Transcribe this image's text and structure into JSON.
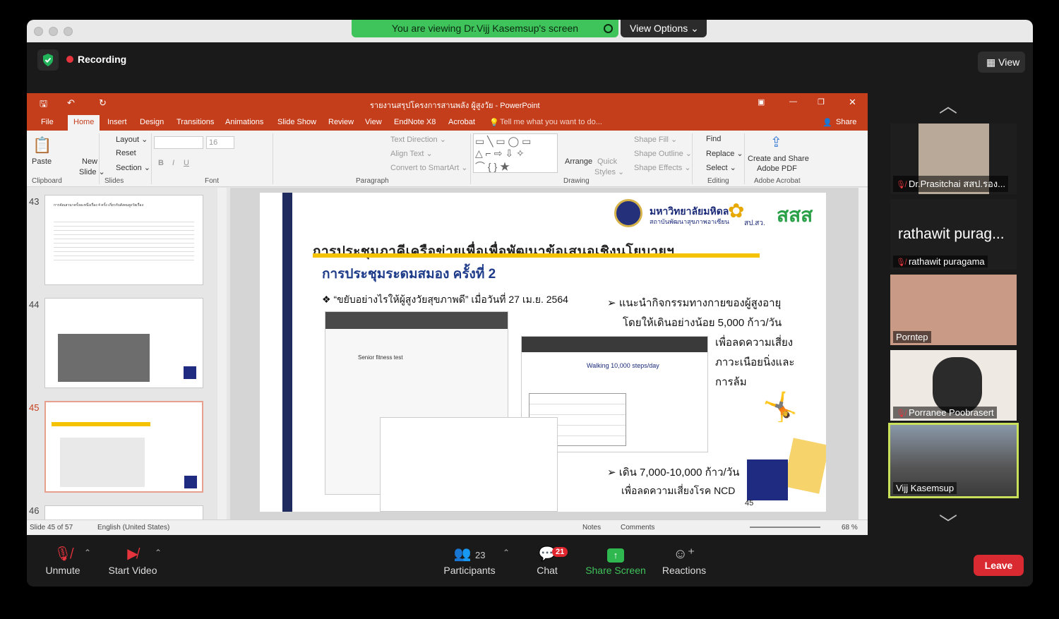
{
  "banner": {
    "viewing": "You are viewing Dr.Vijj Kasemsup's screen",
    "view_options": "View Options ⌄"
  },
  "topbar": {
    "recording": "Recording",
    "view": "View"
  },
  "ppt": {
    "window_title": "รายงานสรุปโครงการสานพลัง ผู้สูงวัย - PowerPoint",
    "tabs": [
      "File",
      "Home",
      "Insert",
      "Design",
      "Transitions",
      "Animations",
      "Slide Show",
      "Review",
      "View",
      "EndNote X8",
      "Acrobat"
    ],
    "tell_me": "Tell me what you want to do...",
    "share": "Share",
    "ribbon": {
      "paste": "Paste",
      "clipboard": "Clipboard",
      "new_slide": "New",
      "new_slide2": "Slide ⌄",
      "layout": "Layout ⌄",
      "reset": "Reset",
      "section": "Section ⌄",
      "slides": "Slides",
      "font_size": "16",
      "font": "Font",
      "text_direction": "Text Direction ⌄",
      "align_text": "Align Text ⌄",
      "convert": "Convert to SmartArt ⌄",
      "paragraph": "Paragraph",
      "arrange": "Arrange",
      "quick_styles": "Quick",
      "quick_styles2": "Styles ⌄",
      "shape_fill": "Shape Fill ⌄",
      "shape_outline": "Shape Outline ⌄",
      "shape_effects": "Shape Effects ⌄",
      "drawing": "Drawing",
      "find": "Find",
      "replace": "Replace ⌄",
      "select": "Select ⌄",
      "editing": "Editing",
      "create_share": "Create and Share",
      "adobe_pdf": "Adobe PDF",
      "adobe_acrobat": "Adobe Acrobat"
    },
    "thumbnails": [
      {
        "num": "43",
        "title": "การจัดเสวนาครั้งละหนึ่งเรื่อง 4 ครั้ง เกี่ยวกับสังคมสูงวัยเรื่อง"
      },
      {
        "num": "44"
      },
      {
        "num": "45"
      },
      {
        "num": "46"
      }
    ],
    "slide": {
      "logo_name": "มหาวิทยาลัยมหิดล",
      "logo_sub": "สถาบันพัฒนาสุขภาพอาเซียน",
      "logo_sps": "สป.สว.",
      "logo_sss": "สสส",
      "title": "การประชุมภาคีเครือข่ายเพื่อเพื่อพัฒนาข้อเสนอเชิงนโยบายฯ",
      "subtitle": "การประชุมระดมสมอง ครั้งที่ 2",
      "bullet": "❖  “ขยับอย่างไรให้ผู้สูงวัยสุขภาพดี” เมื่อวันที่ 27 เม.ย. 2564",
      "right1": "➢  แนะนำกิจกรรมทางกายของผู้สูงอายุ",
      "right2": "โดยให้เดินอย่างน้อย 5,000 ก้าว/วัน",
      "right3": "เพื่อลดความเสี่ยง",
      "right4": "ภาวะเนือยนิ่งและ",
      "right5": "การล้ม",
      "bottom1": "➢  เดิน 7,000-10,000 ก้าว/วัน",
      "bottom2": "เพื่อลดความเสี่ยงโรค NCD",
      "slide_number": "45",
      "walking_title": "Walking 10,000 steps/day",
      "fitness_title": "Senior fitness test"
    },
    "status": {
      "slide_of": "Slide 45 of 57",
      "language": "English (United States)",
      "notes": "Notes",
      "comments": "Comments",
      "zoom": "68 %"
    }
  },
  "participants": [
    {
      "name": "Dr.Prasitchai สสป.รอง...",
      "muted": true
    },
    {
      "name": "rathawit puragama",
      "display": "rathawit purag...",
      "muted": true
    },
    {
      "name": "Porntep",
      "muted": false
    },
    {
      "name": "Porranee Poobrasert",
      "muted": true
    },
    {
      "name": "Vijj Kasemsup",
      "muted": false,
      "active": true
    }
  ],
  "toolbar": {
    "unmute": "Unmute",
    "start_video": "Start Video",
    "participants": "Participants",
    "participants_count": "23",
    "chat": "Chat",
    "chat_badge": "21",
    "share_screen": "Share Screen",
    "reactions": "Reactions",
    "leave": "Leave"
  },
  "colors": {
    "ppt_red": "#c43e1c",
    "zoom_green": "#3fc35b",
    "leave_red": "#d92a32",
    "active_speaker": "#c9e05a"
  }
}
